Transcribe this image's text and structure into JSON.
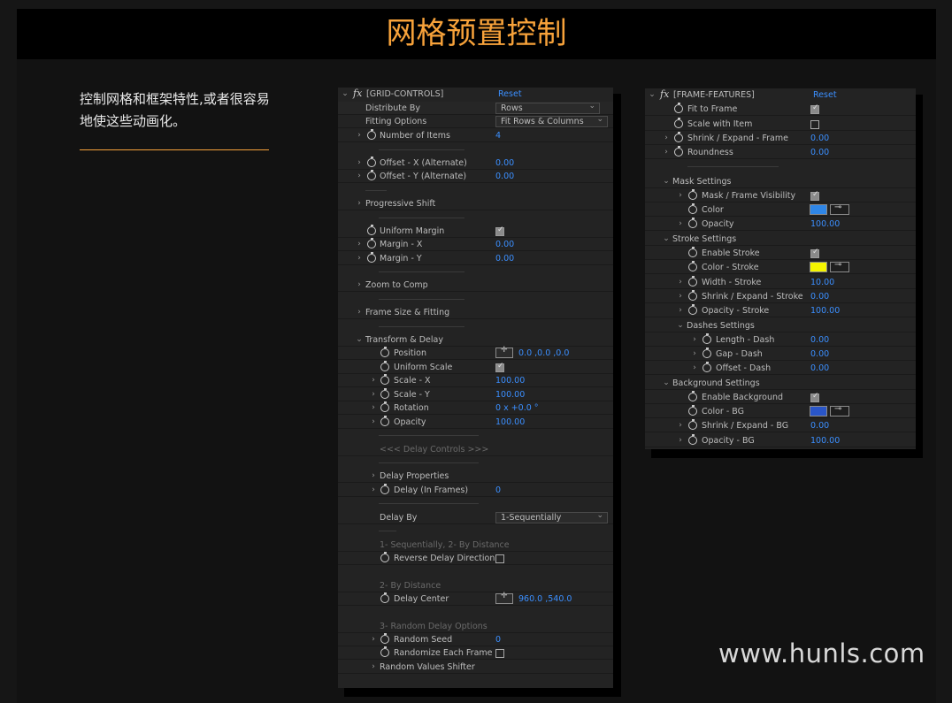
{
  "header": {
    "title": "网格预置控制"
  },
  "intro": {
    "text": "控制网格和框架特性,或者很容易地使这些动画化。"
  },
  "watermark": "www.hunls.com",
  "grid_panel": {
    "effect_name": "[GRID-CONTROLS]",
    "reset_label": "Reset",
    "distribute_by": {
      "label": "Distribute By",
      "value": "Rows"
    },
    "fitting_options": {
      "label": "Fitting Options",
      "value": "Fit Rows & Columns"
    },
    "number_of_items": {
      "label": "Number of Items",
      "value": "4"
    },
    "offset_x": {
      "label": "Offset - X (Alternate)",
      "value": "0.00"
    },
    "offset_y": {
      "label": "Offset - Y (Alternate)",
      "value": "0.00"
    },
    "progressive_shift": "Progressive Shift",
    "uniform_margin": {
      "label": "Uniform Margin",
      "checked": true
    },
    "margin_x": {
      "label": "Margin - X",
      "value": "0.00"
    },
    "margin_y": {
      "label": "Margin - Y",
      "value": "0.00"
    },
    "zoom_to_comp": "Zoom to Comp",
    "frame_size_fitting": "Frame Size & Fitting",
    "transform_delay": "Transform & Delay",
    "position": {
      "label": "Position",
      "value": "0.0 ,0.0 ,0.0"
    },
    "uniform_scale": {
      "label": "Uniform Scale",
      "checked": true
    },
    "scale_x": {
      "label": "Scale - X",
      "value": "100.00"
    },
    "scale_y": {
      "label": "Scale - Y",
      "value": "100.00"
    },
    "rotation": {
      "label": "Rotation",
      "value": "0 x +0.0 °"
    },
    "opacity": {
      "label": "Opacity",
      "value": "100.00"
    },
    "delay_controls_heading": "<<< Delay Controls >>>",
    "delay_properties": "Delay Properties",
    "delay_in_frames": {
      "label": "Delay (In Frames)",
      "value": "0"
    },
    "delay_by": {
      "label": "Delay By",
      "value": "1-Sequentially"
    },
    "delay_by_note": "1- Sequentially, 2- By Distance",
    "reverse_delay": {
      "label": "Reverse Delay Direction",
      "checked": false
    },
    "by_distance_note": "2- By Distance",
    "delay_center": {
      "label": "Delay Center",
      "value": "960.0 ,540.0"
    },
    "random_delay_note": "3- Random Delay Options",
    "random_seed": {
      "label": "Random Seed",
      "value": "0"
    },
    "randomize_each_frame": {
      "label": "Randomize Each Frame",
      "checked": false
    },
    "random_values_shifter": "Random Values Shifter"
  },
  "frame_panel": {
    "effect_name": "[FRAME-FEATURES]",
    "reset_label": "Reset",
    "fit_to_frame": {
      "label": "Fit to Frame",
      "checked": true
    },
    "scale_with_item": {
      "label": "Scale with Item",
      "checked": false
    },
    "shrink_expand_frame": {
      "label": "Shrink / Expand - Frame",
      "value": "0.00"
    },
    "roundness": {
      "label": "Roundness",
      "value": "0.00"
    },
    "mask_settings": "Mask Settings",
    "mask_frame_visibility": {
      "label": "Mask / Frame Visibility",
      "checked": true
    },
    "mask_color": {
      "label": "Color",
      "color": "#2f86e6"
    },
    "mask_opacity": {
      "label": "Opacity",
      "value": "100.00"
    },
    "stroke_settings": "Stroke Settings",
    "enable_stroke": {
      "label": "Enable Stroke",
      "checked": true
    },
    "color_stroke": {
      "label": "Color - Stroke",
      "color": "#f5f500"
    },
    "width_stroke": {
      "label": "Width - Stroke",
      "value": "10.00"
    },
    "shrink_expand_stroke": {
      "label": "Shrink / Expand - Stroke",
      "value": "0.00"
    },
    "opacity_stroke": {
      "label": "Opacity - Stroke",
      "value": "100.00"
    },
    "dashes_settings": "Dashes Settings",
    "length_dash": {
      "label": "Length - Dash",
      "value": "0.00"
    },
    "gap_dash": {
      "label": "Gap - Dash",
      "value": "0.00"
    },
    "offset_dash": {
      "label": "Offset - Dash",
      "value": "0.00"
    },
    "background_settings": "Background Settings",
    "enable_background": {
      "label": "Enable Background",
      "checked": true
    },
    "color_bg": {
      "label": "Color - BG",
      "color": "#2a56c8"
    },
    "shrink_expand_bg": {
      "label": "Shrink / Expand - BG",
      "value": "0.00"
    },
    "opacity_bg": {
      "label": "Opacity - BG",
      "value": "100.00"
    }
  }
}
